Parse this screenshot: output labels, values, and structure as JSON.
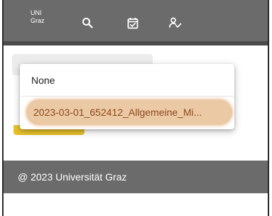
{
  "header": {
    "logo_line1": "UNI",
    "logo_line2": "Graz",
    "nav_icons": [
      "search-icon",
      "calendar-check-icon",
      "person-check-icon"
    ]
  },
  "dropdown": {
    "options": [
      {
        "label": "None",
        "selected": false
      },
      {
        "label": "2023-03-01_652412_Allgemeine_Mi...",
        "selected": true
      }
    ]
  },
  "footer": {
    "text": "@ 2023 Universität Graz"
  },
  "colors": {
    "header_bg": "#6b6b6b",
    "footer_bg": "#6b6b6b",
    "selected_option_bg": "#ecc9a5",
    "selected_option_text": "#8a4b1c",
    "button_yellow": "#e8c22a"
  }
}
